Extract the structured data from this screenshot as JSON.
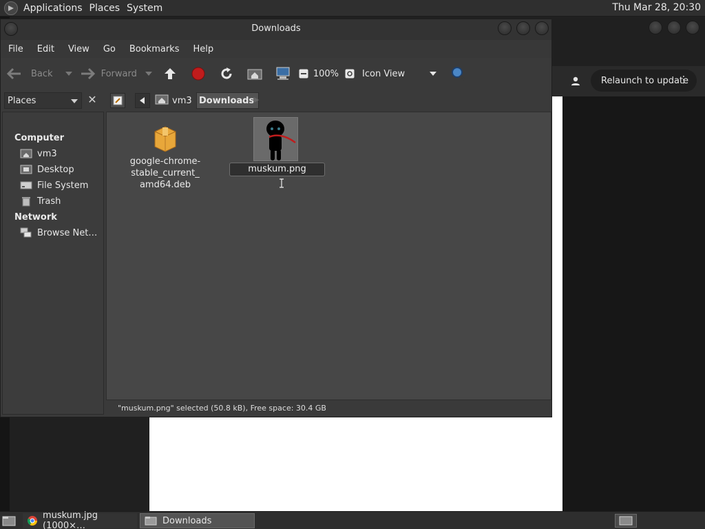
{
  "top_panel": {
    "menus": [
      "Applications",
      "Places",
      "System"
    ],
    "clock": "Thu Mar 28, 20:30"
  },
  "chrome": {
    "relaunch_label": "Relaunch to update"
  },
  "fm": {
    "title": "Downloads",
    "menubar": [
      "File",
      "Edit",
      "View",
      "Go",
      "Bookmarks",
      "Help"
    ],
    "toolbar": {
      "back_label": "Back",
      "forward_label": "Forward",
      "zoom_label": "100%",
      "view_label": "Icon View"
    },
    "pathbar": {
      "places_label": "Places",
      "crumbs": [
        "vm3",
        "Downloads"
      ]
    },
    "sidebar": {
      "computer_label": "Computer",
      "computer_items": [
        "vm3",
        "Desktop",
        "File System",
        "Trash"
      ],
      "network_label": "Network",
      "network_items": [
        "Browse Net…"
      ]
    },
    "files": [
      {
        "name": "google-chrome-stable_current_amd64.deb",
        "name_lines": [
          "google-chrome-",
          "stable_current_",
          "amd64.deb"
        ],
        "icon": "package-icon"
      },
      {
        "name": "muskum.png",
        "icon": "image-thumbnail"
      }
    ],
    "status": "\"muskum.png\" selected (50.8 kB), Free space: 30.4 GB"
  },
  "taskbar": {
    "tasks": [
      "muskum.jpg (1000×…",
      "Downloads"
    ]
  },
  "colors": {
    "accent_red": "#c01c1c",
    "selection": "#545454"
  }
}
